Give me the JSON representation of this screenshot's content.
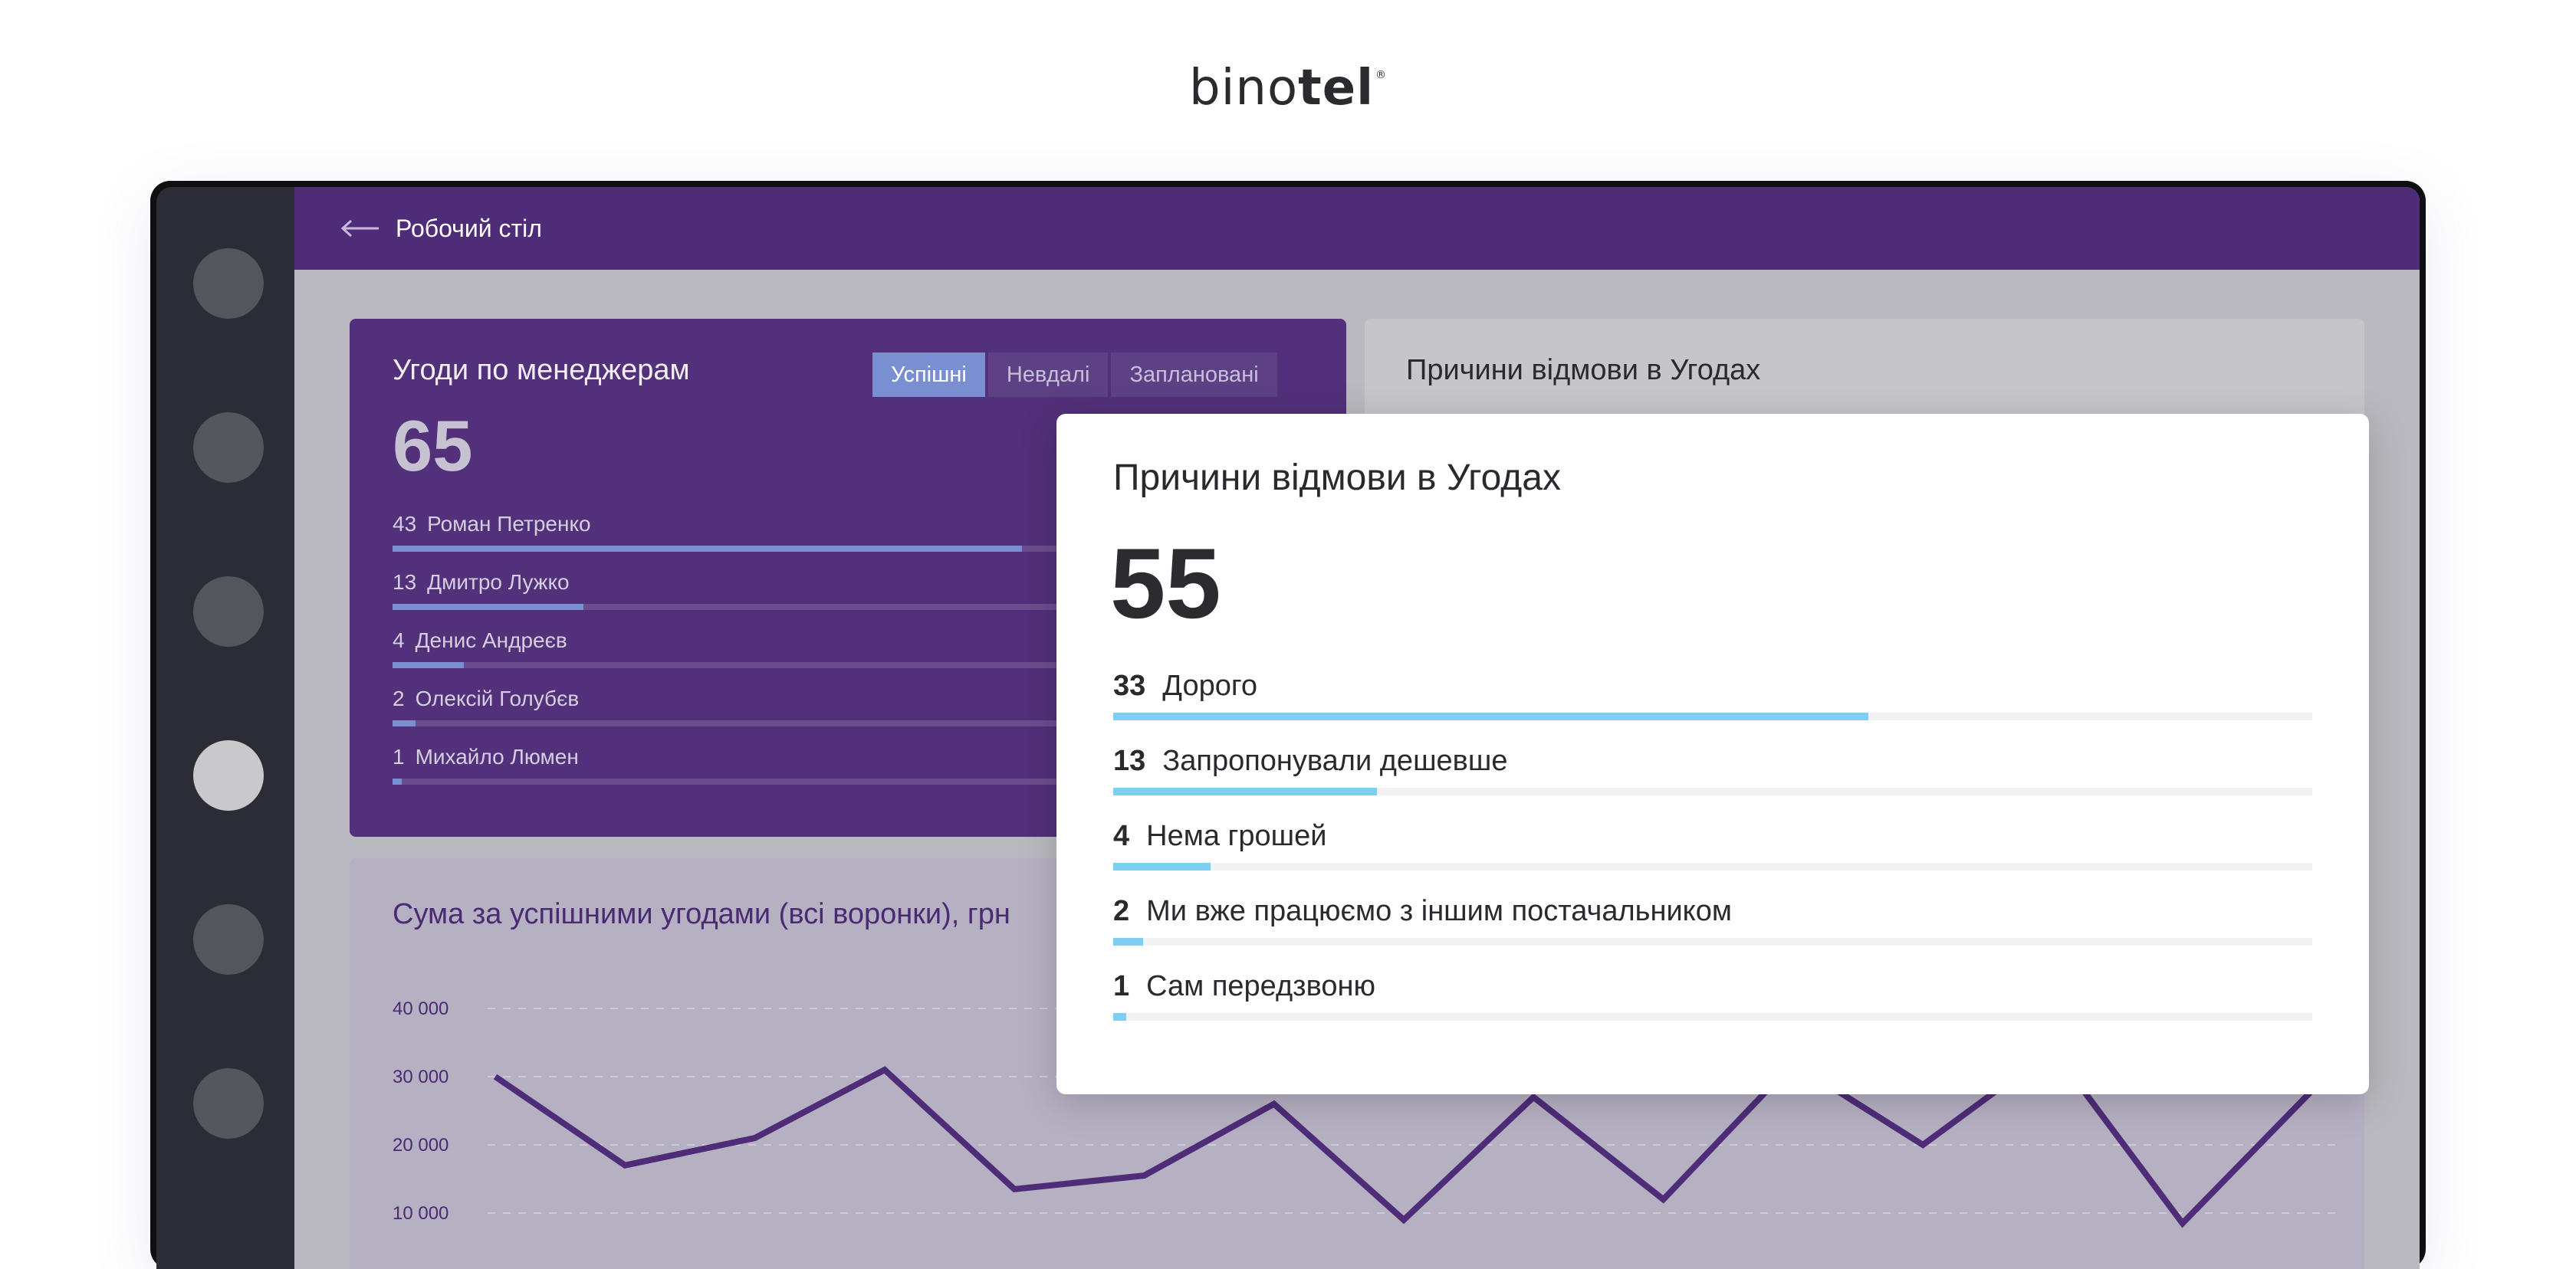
{
  "brand": {
    "regular": "bino",
    "bold": "tel",
    "mark": "®"
  },
  "topbar": {
    "back_label": "Робочий стіл"
  },
  "deals_card": {
    "title": "Угоди по менеджерам",
    "tabs": [
      {
        "label": "Успішні",
        "active": true
      },
      {
        "label": "Невдалі",
        "active": false
      },
      {
        "label": "Заплановані",
        "active": false
      }
    ],
    "total": "65",
    "managers": [
      {
        "count": "43",
        "name": "Роман Петренко",
        "fraction": 0.66
      },
      {
        "count": "13",
        "name": "Дмитро Лужко",
        "fraction": 0.2
      },
      {
        "count": "4",
        "name": "Денис Андреєв",
        "fraction": 0.075
      },
      {
        "count": "2",
        "name": "Олексій Голубєв",
        "fraction": 0.024
      },
      {
        "count": "1",
        "name": "Михайло Люмен",
        "fraction": 0.01
      }
    ]
  },
  "reasons_card": {
    "title": "Причини відмови в Угодах"
  },
  "sum_card": {
    "title": "Сума за успішними угодами (всі воронки), грн",
    "chart_data": {
      "type": "line",
      "ylim": [
        0,
        40000
      ],
      "yticks": [
        "40 000",
        "30 000",
        "20 000",
        "10 000"
      ],
      "series": [
        {
          "values": [
            30000,
            17000,
            21000,
            31000,
            13500,
            15500,
            26000,
            9000,
            27000,
            12000,
            32000,
            20000,
            34000,
            8500,
            28000
          ]
        }
      ]
    }
  },
  "popup": {
    "title": "Причини відмови в Угодах",
    "total": "55",
    "reasons": [
      {
        "count": "33",
        "label": "Дорого",
        "fraction": 0.63
      },
      {
        "count": "13",
        "label": "Запропонували дешевше",
        "fraction": 0.22
      },
      {
        "count": "4",
        "label": "Нема грошей",
        "fraction": 0.081
      },
      {
        "count": "2",
        "label": "Ми вже працюємо з іншим постачальником",
        "fraction": 0.025
      },
      {
        "count": "1",
        "label": "Сам передзвоню",
        "fraction": 0.011
      }
    ]
  },
  "colors": {
    "purple": "#4f2c78",
    "accent_blue": "#7ecdf2",
    "tab_active": "#7a8fd1"
  }
}
